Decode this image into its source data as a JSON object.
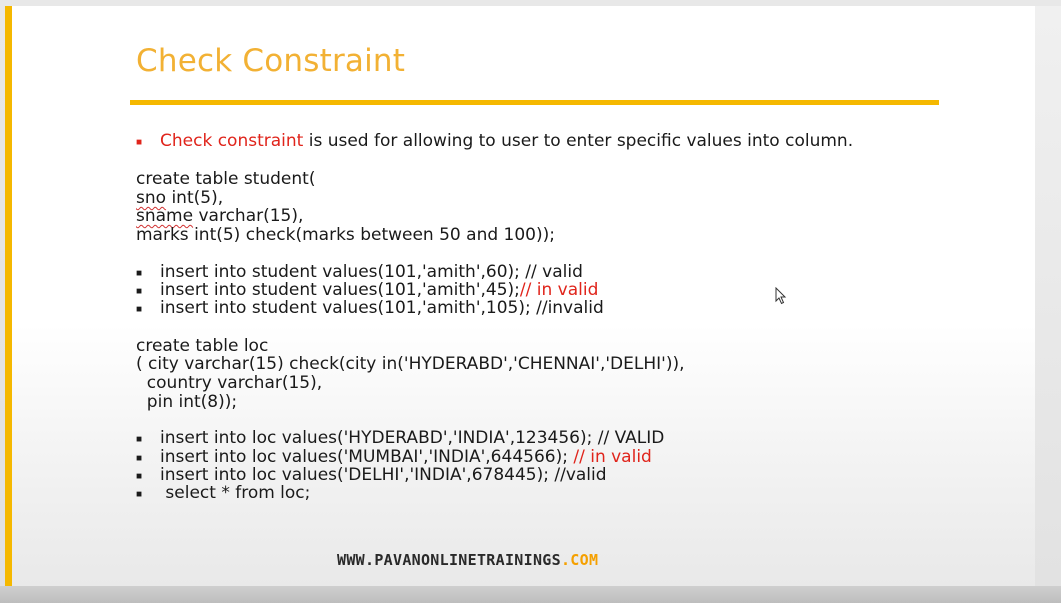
{
  "slide": {
    "title": "Check Constraint",
    "intro": {
      "highlight": "Check constraint",
      "rest": " is used for allowing to user to enter specific values into column."
    },
    "student_table": [
      "create table student(",
      "int(5),",
      "varchar(15),",
      "marks int(5) check(marks between 50 and 100));"
    ],
    "student_col_names": [
      "sno",
      "sname"
    ],
    "student_inserts": [
      {
        "text": "insert into student values(101,'amith',60); // valid",
        "note": ""
      },
      {
        "text": "insert into student values(101,'amith',45);",
        "note": "// in valid"
      },
      {
        "text": "insert into student values(101,'amith',105); //invalid",
        "note": ""
      }
    ],
    "loc_table": [
      "create table loc",
      "( city varchar(15) check(city in('HYDERABD','CHENNAI','DELHI')),",
      "  country varchar(15),",
      "  pin int(8));"
    ],
    "loc_inserts": [
      {
        "text": "insert into loc values('HYDERABD','INDIA',123456); // VALID",
        "note": ""
      },
      {
        "text": "insert into loc values('MUMBAI','INDIA',644566); ",
        "note": "// in valid"
      },
      {
        "text": "insert into loc values('DELHI','INDIA',678445); //valid",
        "note": ""
      },
      {
        "text": " select * from loc;",
        "note": ""
      }
    ],
    "footer": {
      "site": "WWW.PAVANONLINETRAININGS",
      "domain": ".COM"
    }
  },
  "colors": {
    "accent": "#f5b800",
    "title": "#f2b134",
    "highlight": "#e0241b"
  }
}
